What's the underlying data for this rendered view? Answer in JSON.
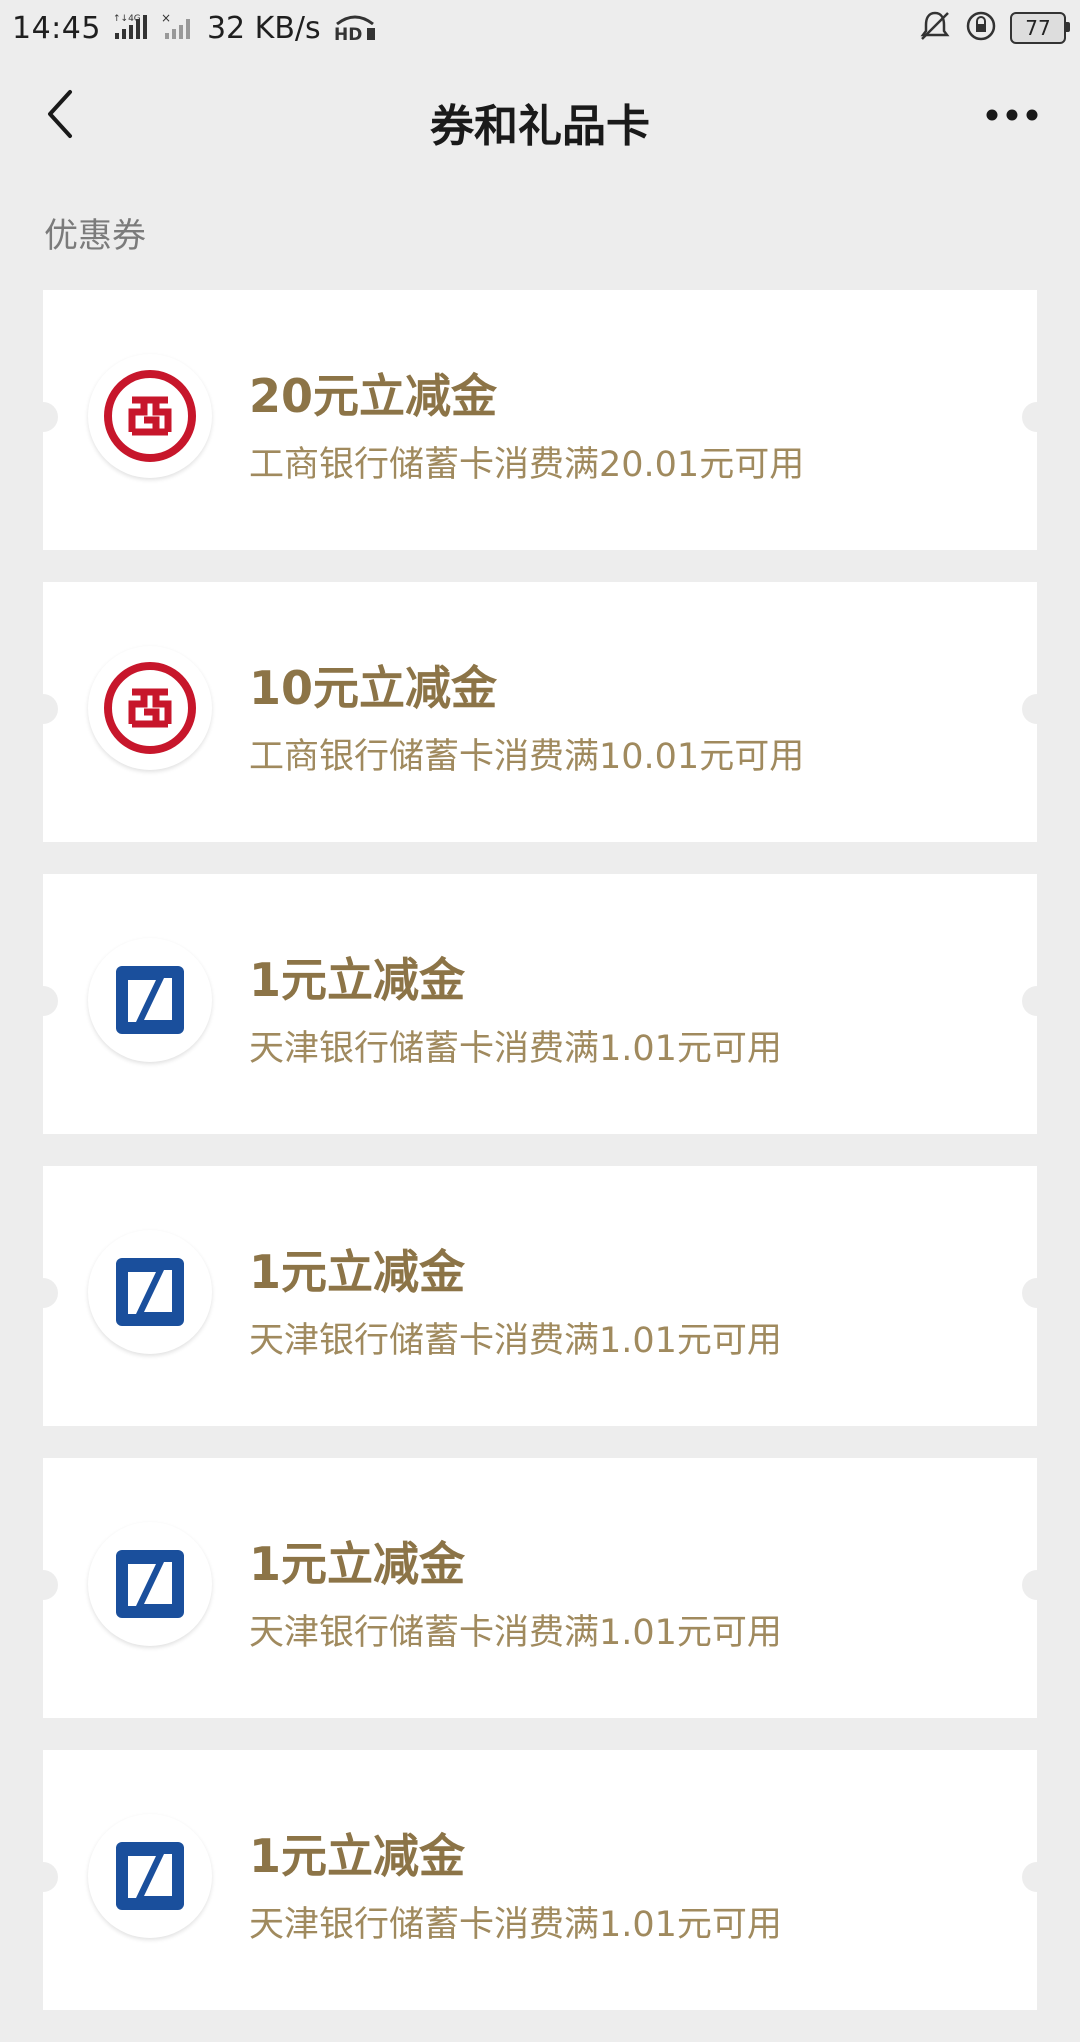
{
  "status_bar": {
    "time": "14:45",
    "network_speed": "32 KB/s",
    "battery_level": "77",
    "icons": [
      "4g-signal-icon",
      "signal-x-icon",
      "hd-icon",
      "mute-bell-icon",
      "rotation-lock-icon",
      "battery-icon"
    ]
  },
  "header": {
    "title": "券和礼品卡",
    "back_icon": "chevron-left-icon",
    "more_icon": "more-dots-icon"
  },
  "section": {
    "label": "优惠券"
  },
  "coupons": [
    {
      "bank": "icbc",
      "title": "20元立减金",
      "description": "工商银行储蓄卡消费满20.01元可用"
    },
    {
      "bank": "icbc",
      "title": "10元立减金",
      "description": "工商银行储蓄卡消费满10.01元可用"
    },
    {
      "bank": "tianjin",
      "title": "1元立减金",
      "description": "天津银行储蓄卡消费满1.01元可用"
    },
    {
      "bank": "tianjin",
      "title": "1元立减金",
      "description": "天津银行储蓄卡消费满1.01元可用"
    },
    {
      "bank": "tianjin",
      "title": "1元立减金",
      "description": "天津银行储蓄卡消费满1.01元可用"
    },
    {
      "bank": "tianjin",
      "title": "1元立减金",
      "description": "天津银行储蓄卡消费满1.01元可用"
    }
  ],
  "colors": {
    "background": "#ededed",
    "card": "#ffffff",
    "coupon_title": "#8c7447",
    "coupon_desc": "#a08a5e",
    "icbc_red": "#c7162b",
    "tianjin_blue": "#1a4f9c"
  }
}
